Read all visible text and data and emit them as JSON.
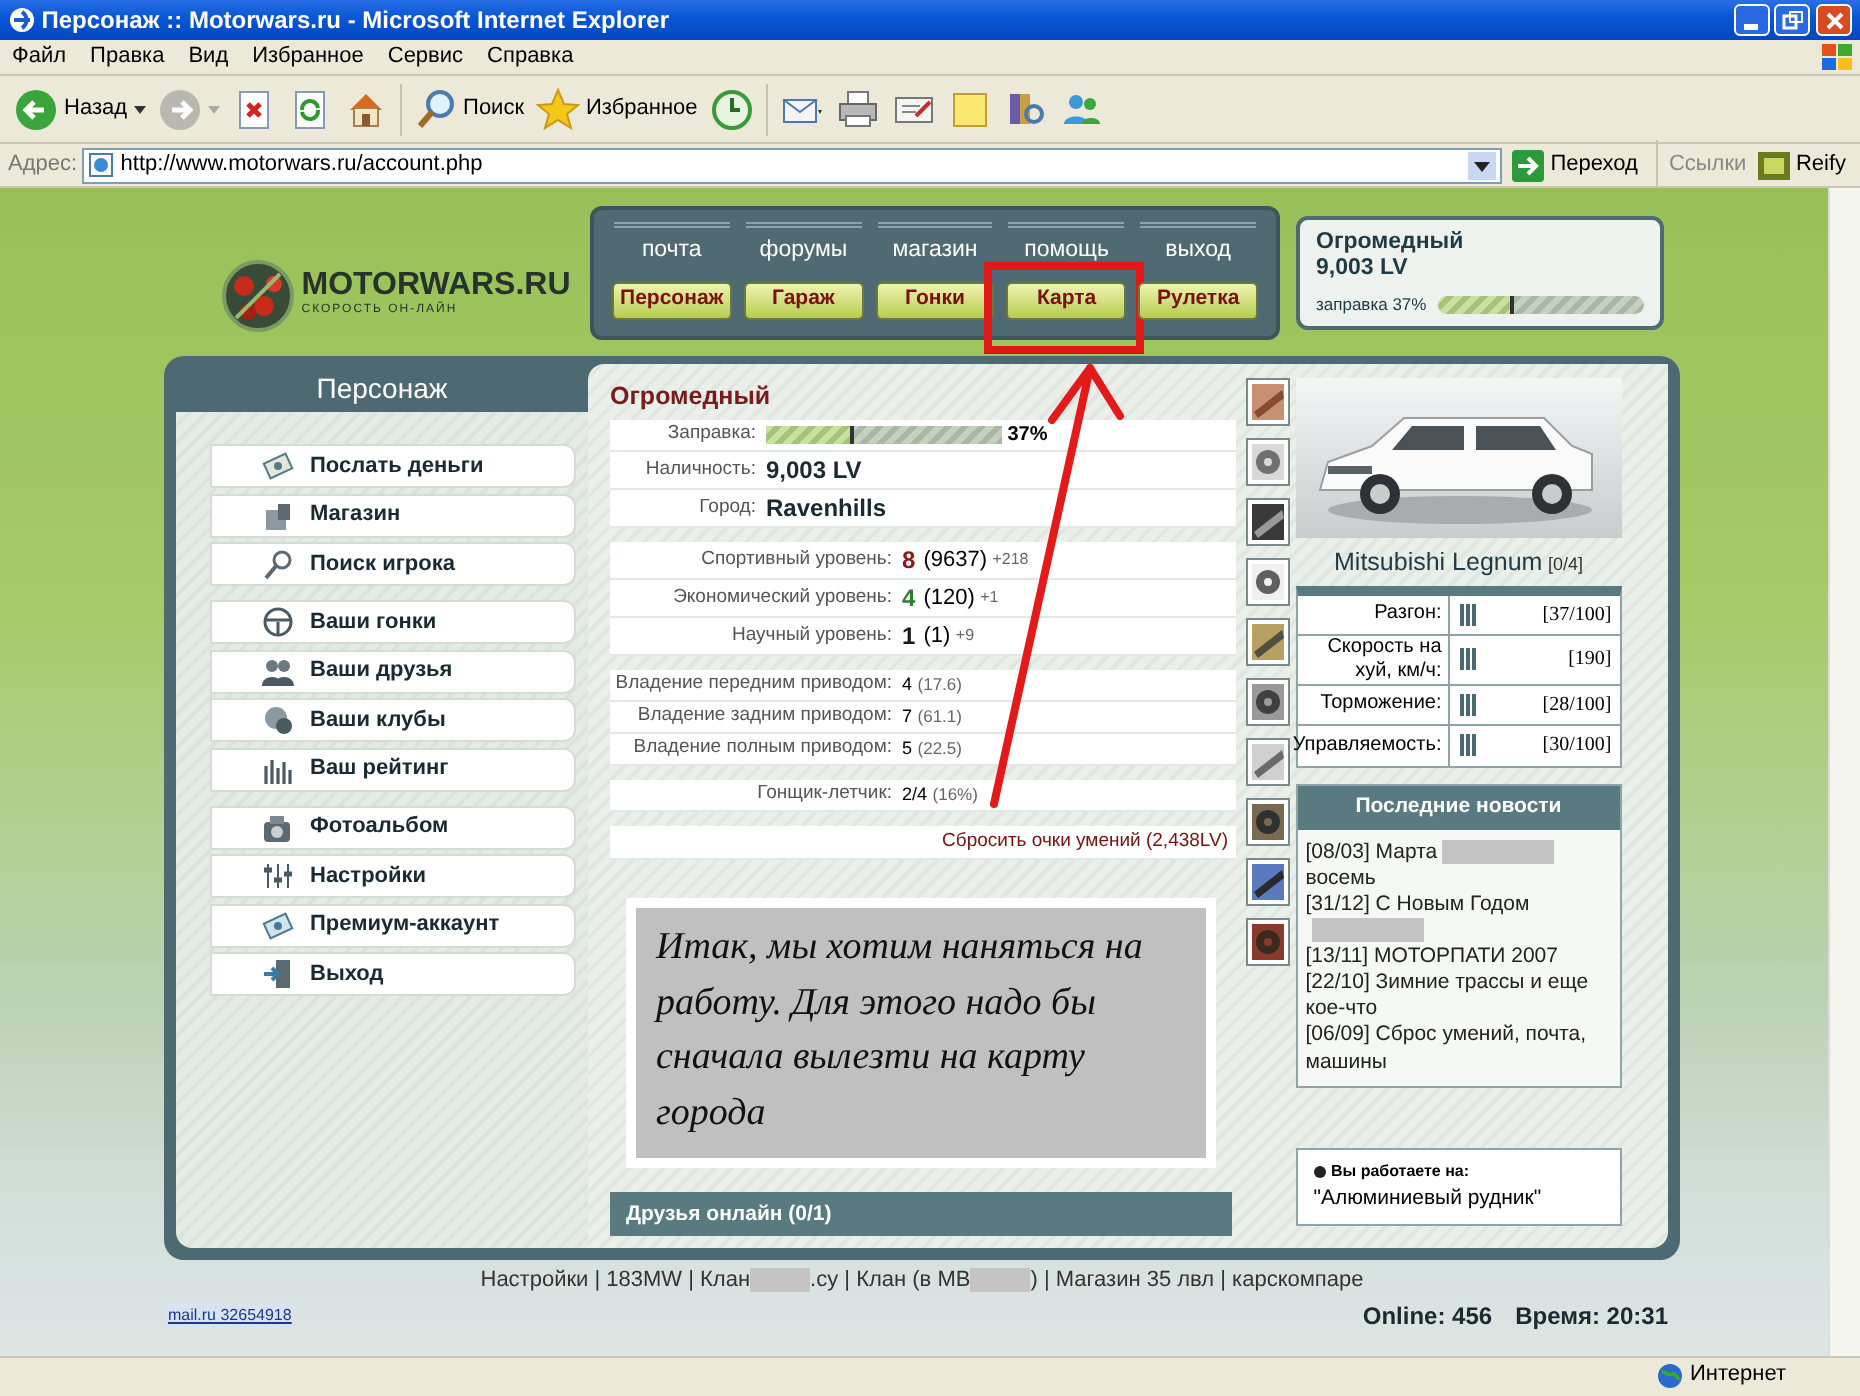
{
  "window": {
    "title": "Персонаж :: Motorwars.ru - Microsoft Internet Explorer"
  },
  "menu": [
    "Файл",
    "Правка",
    "Вид",
    "Избранное",
    "Сервис",
    "Справка"
  ],
  "toolbar": [
    {
      "kind": "back",
      "label": "Назад"
    },
    {
      "kind": "forward"
    },
    {
      "kind": "stop"
    },
    {
      "kind": "refresh"
    },
    {
      "kind": "home"
    },
    {
      "kind": "search",
      "label": "Поиск"
    },
    {
      "kind": "favorites",
      "label": "Избранное"
    },
    {
      "kind": "history"
    },
    {
      "kind": "mail"
    },
    {
      "kind": "print"
    },
    {
      "kind": "edit"
    },
    {
      "kind": "note"
    },
    {
      "kind": "research"
    },
    {
      "kind": "messenger"
    }
  ],
  "address_bar": {
    "label": "Адрес:",
    "url": "http://www.motorwars.ru/account.php",
    "go": "Переход",
    "links": "Ссылки",
    "addon": "Reify"
  },
  "site": {
    "logo": "MOTORWARS.RU",
    "tagline": "СКОРОСТЬ ОН-ЛАЙН",
    "top_links": [
      "почта",
      "форумы",
      "магазин",
      "помощь",
      "выход"
    ],
    "nav_buttons": [
      {
        "label": "Персонаж",
        "highlighted": false
      },
      {
        "label": "Гараж",
        "highlighted": false
      },
      {
        "label": "Гонки",
        "highlighted": false
      },
      {
        "label": "Карта",
        "highlighted": true
      },
      {
        "label": "Рулетка",
        "highlighted": false
      }
    ],
    "player": {
      "name": "Огромедный",
      "money": "9,003 LV",
      "fuel_label": "заправка 37%",
      "level": 0.37
    }
  },
  "panel_tab": "Персонаж",
  "sidebar": [
    [
      {
        "kind": "money",
        "label": "Послать деньги"
      },
      {
        "kind": "shop",
        "label": "Магазин"
      },
      {
        "kind": "search",
        "label": "Поиск игрока"
      }
    ],
    [
      {
        "kind": "wheel",
        "label": "Ваши гонки"
      },
      {
        "kind": "friends",
        "label": "Ваши друзья"
      },
      {
        "kind": "clubs",
        "label": "Ваши клубы"
      },
      {
        "kind": "rating",
        "label": "Ваш рейтинг"
      }
    ],
    [
      {
        "kind": "camera",
        "label": "Фотоальбом"
      },
      {
        "kind": "settings",
        "label": "Настройки"
      },
      {
        "kind": "premium",
        "label": "Премиум-аккаунт"
      },
      {
        "kind": "exit",
        "label": "Выход"
      }
    ]
  ],
  "profile": {
    "name": "Огромедный",
    "sections": [
      {
        "rows": [
          {
            "kind": "bar",
            "label": "Заправка:",
            "level": 0.37,
            "reading": "37%"
          },
          {
            "kind": "text",
            "label": "Наличность:",
            "value": "9,003 LV"
          },
          {
            "kind": "text",
            "label": "Город:",
            "value": "Ravenhills"
          }
        ]
      },
      {
        "rows": [
          {
            "kind": "level",
            "label": "Спортивный уровень:",
            "value": "8",
            "color": "#8b1a1a",
            "detail": "(9637)",
            "bonus": "+218"
          },
          {
            "kind": "level",
            "label": "Экономический уровень:",
            "value": "4",
            "color": "#2e7d32",
            "detail": "(120)",
            "bonus": "+1"
          },
          {
            "kind": "level",
            "label": "Научный уровень:",
            "value": "1",
            "color": "#1a1a1a",
            "detail": "(1)",
            "bonus": "+9"
          }
        ]
      },
      {
        "rows": [
          {
            "kind": "skill",
            "label": "Владение передним приводом:",
            "value": "4",
            "detail": "(17.6)"
          },
          {
            "kind": "skill",
            "label": "Владение задним приводом:",
            "value": "7",
            "detail": "(61.1)"
          },
          {
            "kind": "skill",
            "label": "Владение полным приводом:",
            "value": "5",
            "detail": "(22.5)"
          }
        ]
      },
      {
        "rows": [
          {
            "kind": "skill",
            "label": "Гонщик-летчик:",
            "value": "2/4",
            "detail": "(16%)"
          }
        ]
      },
      {
        "rows": [
          {
            "kind": "link",
            "text": "Сбросить очки умений (2,438LV)"
          }
        ]
      }
    ]
  },
  "note": "Итак, мы хотим наняться на работу. Для этого надо бы сначала вылезти на карту города",
  "friends": "Друзья онлайн (0/1)",
  "car": {
    "name": "Mitsubishi Legnum",
    "slots": "[0/4]",
    "stats": [
      {
        "label": "Разгон:",
        "reading": "[37/100]"
      },
      {
        "label": "Скорость на хуй, км/ч:",
        "reading": "[190]"
      },
      {
        "label": "Торможение:",
        "reading": "[28/100]"
      },
      {
        "label": "Управляемость:",
        "reading": "[30/100]"
      }
    ]
  },
  "news": {
    "title": "Последние новости",
    "items": [
      {
        "date": "[08/03]",
        "text": "Марта",
        "redacted": true,
        "tail": "восемь"
      },
      {
        "date": "[31/12]",
        "text": "С Новым Годом",
        "redacted": true
      },
      {
        "date": "[13/11]",
        "text": "МОТОРПАТИ 2007",
        "redacted": false
      },
      {
        "date": "[22/10]",
        "text": "Зимние трассы и еще кое-что",
        "redacted": false
      },
      {
        "date": "[06/09]",
        "text": "Сброс умений, почта, машины",
        "redacted": false
      }
    ]
  },
  "job": {
    "label": "Вы работаете на:",
    "place": "\"Алюминиевый рудник\""
  },
  "footer": {
    "segments": [
      {
        "kind": "text",
        "text": "Настройки | 183MW | Клан"
      },
      {
        "kind": "redacted"
      },
      {
        "kind": "text",
        "text": ".cy | Клан (в МВ"
      },
      {
        "kind": "redacted"
      },
      {
        "kind": "text",
        "text": ") | Магазин 35 лвл | карскомпаре"
      }
    ],
    "counter": {
      "site": "mail.ru",
      "number": "32654918"
    },
    "online": "Online: 456",
    "time": "Время: 20:31"
  },
  "status_bar": {
    "zone": "Интернет"
  }
}
